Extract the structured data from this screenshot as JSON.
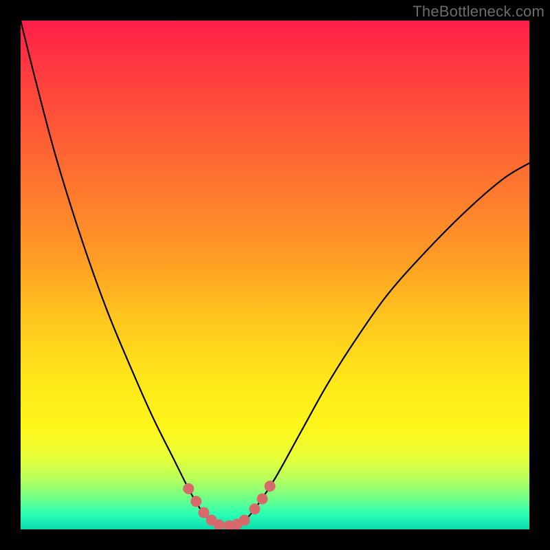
{
  "watermark": "TheBottleneck.com",
  "colors": {
    "background": "#000000",
    "gradient_top": "#ff1f4a",
    "gradient_bottom": "#0dd8b0",
    "curve": "#000000",
    "marker": "#d66a6a"
  },
  "chart_data": {
    "type": "line",
    "title": "",
    "xlabel": "",
    "ylabel": "",
    "xlim": [
      0,
      100
    ],
    "ylim": [
      0,
      100
    ],
    "grid": false,
    "legend": false,
    "series": [
      {
        "name": "bottleneck-curve",
        "color": "#000000",
        "x": [
          0,
          3,
          7,
          12,
          17,
          22,
          26,
          30,
          33,
          35,
          36.5,
          38,
          40,
          42,
          44,
          46,
          50,
          55,
          60,
          65,
          72,
          80,
          88,
          95,
          100
        ],
        "y": [
          100,
          88,
          73,
          57,
          43,
          31,
          22,
          14,
          8,
          4.5,
          2.5,
          1.4,
          0.7,
          0.8,
          1.8,
          4,
          10,
          19,
          28,
          36,
          46,
          55,
          63,
          69,
          72
        ],
        "note": "y is percent of plot height from bottom; higher = worse (red), lower = better (green). Minimum near x≈40."
      }
    ],
    "markers": [
      {
        "x": 33.0,
        "y": 8.0
      },
      {
        "x": 34.5,
        "y": 5.5
      },
      {
        "x": 36.0,
        "y": 3.3
      },
      {
        "x": 37.5,
        "y": 1.8
      },
      {
        "x": 39.0,
        "y": 0.9
      },
      {
        "x": 41.0,
        "y": 0.7
      },
      {
        "x": 42.5,
        "y": 1.0
      },
      {
        "x": 44.0,
        "y": 1.8
      },
      {
        "x": 46.0,
        "y": 4.0
      },
      {
        "x": 47.5,
        "y": 6.0
      },
      {
        "x": 49.0,
        "y": 8.5
      }
    ],
    "marker_style": {
      "color": "#d66a6a",
      "radius_px": 8
    }
  }
}
